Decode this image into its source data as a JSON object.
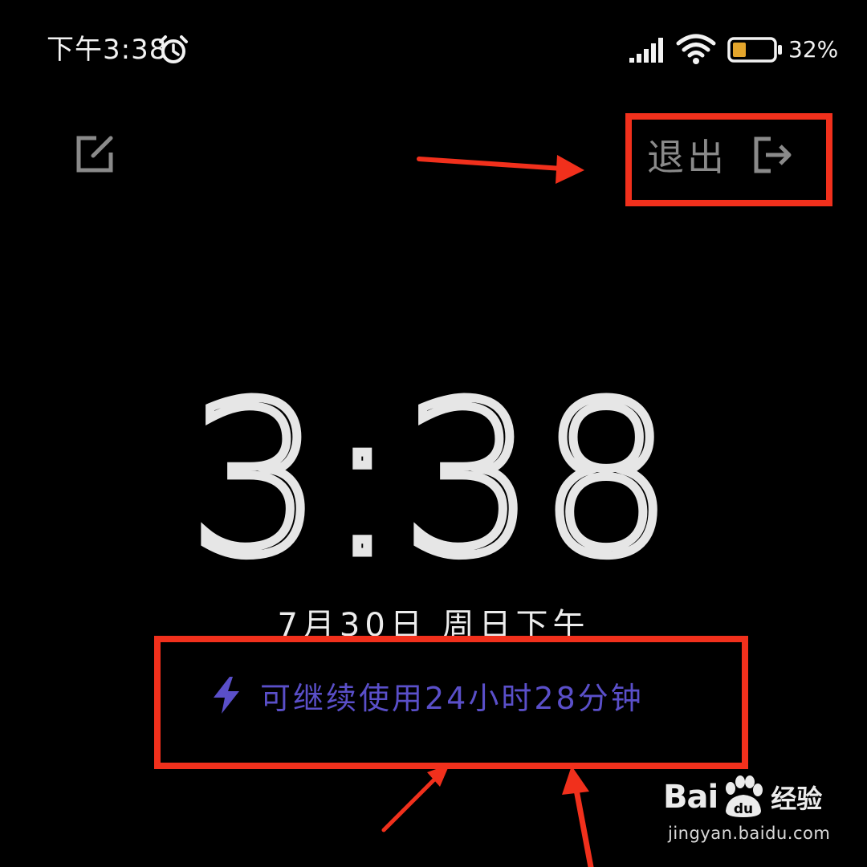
{
  "status_bar": {
    "time": "下午3:38",
    "alarm_icon": "alarm-clock-icon",
    "signal_icon": "cellular-signal-icon",
    "wifi_icon": "wifi-icon",
    "battery_icon": "battery-icon",
    "battery_level": 0.32,
    "battery_percent": "32%",
    "battery_fill_color": "#e3a52c"
  },
  "top_actions": {
    "edit_icon": "edit-icon",
    "exit_label": "退出",
    "exit_icon": "logout-icon"
  },
  "clock": {
    "time": "3:38",
    "date": "7月30日 周日下午"
  },
  "battery_estimate": {
    "icon": "lightning-bolt-icon",
    "text": "可继续使用24小时28分钟",
    "color": "#5a4fc9"
  },
  "annotations": {
    "color": "#f1301c"
  },
  "watermark": {
    "logo_prefix": "Bai",
    "logo_du": "du",
    "logo_cn": "经验",
    "url": "jingyan.baidu.com"
  }
}
